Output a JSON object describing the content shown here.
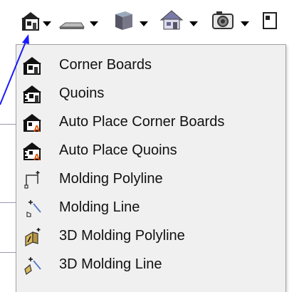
{
  "toolbar": {
    "buttons": [
      {
        "name": "corner-boards-tool",
        "icon": "house-corner-icon"
      },
      {
        "name": "molding-tool",
        "icon": "molding-profile-icon"
      },
      {
        "name": "3d-box-tool",
        "icon": "cube-icon"
      },
      {
        "name": "house-tool",
        "icon": "house-icon"
      },
      {
        "name": "camera-tool",
        "icon": "camera-icon"
      }
    ]
  },
  "menu": {
    "items": [
      {
        "label": "Corner Boards",
        "icon": "corner-boards-icon"
      },
      {
        "label": "Quoins",
        "icon": "quoins-icon"
      },
      {
        "label": "Auto Place Corner Boards",
        "icon": "auto-corner-boards-icon"
      },
      {
        "label": "Auto Place Quoins",
        "icon": "auto-quoins-icon"
      },
      {
        "label": "Molding Polyline",
        "icon": "molding-polyline-icon"
      },
      {
        "label": "Molding Line",
        "icon": "molding-line-icon"
      },
      {
        "label": "3D Molding Polyline",
        "icon": "3d-molding-polyline-icon"
      },
      {
        "label": "3D Molding Line",
        "icon": "3d-molding-line-icon"
      }
    ]
  },
  "colors": {
    "menu_bg": "#f0f0f0",
    "annotation_arrow": "#1a1aff"
  }
}
